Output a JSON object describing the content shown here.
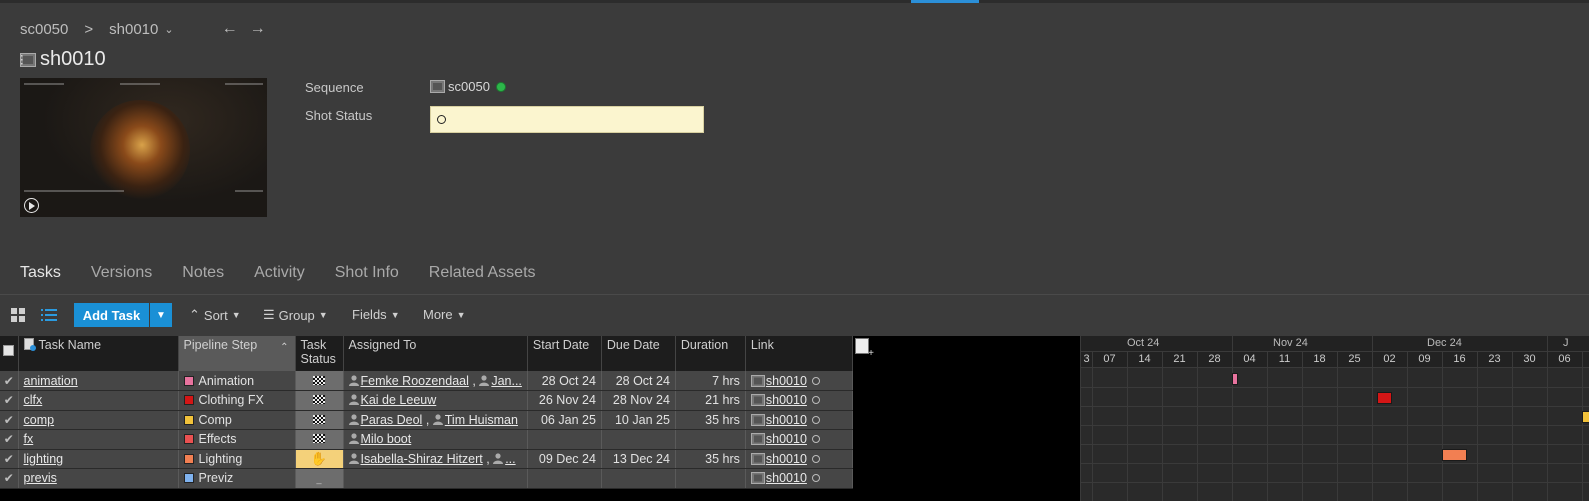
{
  "breadcrumb": {
    "sequence": "sc0050",
    "separator": ">",
    "shot": "sh0010",
    "back_arrow": "←",
    "forward_arrow": "→"
  },
  "page": {
    "title": "sh0010"
  },
  "fields": {
    "sequence_label": "Sequence",
    "sequence_value": "sc0050",
    "shot_status_label": "Shot Status"
  },
  "tabs": [
    "Tasks",
    "Versions",
    "Notes",
    "Activity",
    "Shot Info",
    "Related Assets"
  ],
  "toolbar": {
    "add_task": "Add Task",
    "sort": "Sort",
    "group": "Group",
    "fields": "Fields",
    "more": "More"
  },
  "columns": {
    "task_name": "Task Name",
    "pipeline_step": "Pipeline Step",
    "task_status_line1": "Task",
    "task_status_line2": "Status",
    "assigned_to": "Assigned To",
    "start_date": "Start Date",
    "due_date": "Due Date",
    "duration": "Duration",
    "link": "Link"
  },
  "rows": [
    {
      "name": "animation",
      "step": "Animation",
      "step_color": "#e8739e",
      "status": "checker",
      "assigned": [
        "Femke Roozendaal",
        "Jan..."
      ],
      "start": "28 Oct 24",
      "due": "28 Oct 24",
      "duration": "7 hrs",
      "link": "sh0010"
    },
    {
      "name": "clfx",
      "step": "Clothing FX",
      "step_color": "#d41616",
      "status": "checker",
      "assigned": [
        "Kai de Leeuw"
      ],
      "start": "26 Nov 24",
      "due": "28 Nov 24",
      "duration": "21 hrs",
      "link": "sh0010"
    },
    {
      "name": "comp",
      "step": "Comp",
      "step_color": "#f2c23a",
      "status": "checker",
      "assigned": [
        "Paras Deol",
        "Tim Huisman"
      ],
      "start": "06 Jan 25",
      "due": "10 Jan 25",
      "duration": "35 hrs",
      "link": "sh0010"
    },
    {
      "name": "fx",
      "step": "Effects",
      "step_color": "#ea5151",
      "status": "checker",
      "assigned": [
        "Milo boot"
      ],
      "start": "",
      "due": "",
      "duration": "",
      "link": "sh0010"
    },
    {
      "name": "lighting",
      "step": "Lighting",
      "step_color": "#f27f52",
      "status": "in-progress",
      "assigned": [
        "Isabella-Shiraz Hitzert",
        "..."
      ],
      "start": "09 Dec 24",
      "due": "13 Dec 24",
      "duration": "35 hrs",
      "link": "sh0010"
    },
    {
      "name": "previs",
      "step": "Previz",
      "step_color": "#7fb2ee",
      "status": "none",
      "assigned": [],
      "start": "",
      "due": "",
      "duration": "",
      "link": "sh0010"
    }
  ],
  "gantt": {
    "months": [
      {
        "label": "Oct 24"
      },
      {
        "label": "Nov 24"
      },
      {
        "label": "Dec 24"
      },
      {
        "label": "J"
      }
    ],
    "weeks": [
      "3",
      "07",
      "14",
      "21",
      "28",
      "04",
      "11",
      "18",
      "25",
      "02",
      "09",
      "16",
      "23",
      "30",
      "06"
    ]
  },
  "colors": {
    "accent": "#1a90d6",
    "status_field_bg": "#fbf5cf",
    "sequence_status": "#2db64a",
    "in_progress_status": "#f4d17a"
  }
}
